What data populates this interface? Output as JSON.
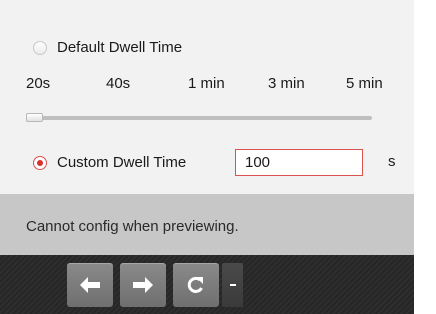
{
  "dwell": {
    "default_label": "Default Dwell Time",
    "default_selected": false,
    "ticks": [
      "20s",
      "40s",
      "1 min",
      "3 min",
      "5 min"
    ],
    "slider_level": 0,
    "custom_label": "Custom Dwell Time",
    "custom_selected": true,
    "custom_value": "100",
    "unit": "s"
  },
  "status": {
    "message": "Cannot config when previewing."
  },
  "toolbar": {
    "buttons": [
      {
        "icon": "arrow-left-icon"
      },
      {
        "icon": "arrow-right-icon"
      },
      {
        "icon": "refresh-icon"
      }
    ],
    "dropdown_icon": "dropdown-icon"
  },
  "colors": {
    "accent": "#d9302c",
    "panel": "#f2f2f2",
    "status_bar": "#c7c7c7",
    "toolbar": "#2a2a2a"
  }
}
